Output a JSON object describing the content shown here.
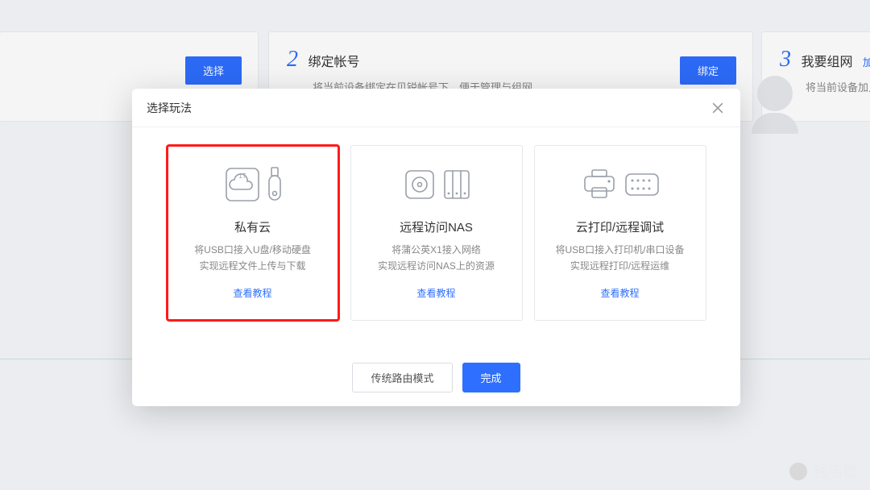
{
  "bg": {
    "step1_select_btn": "选择",
    "step2_num": "2",
    "step2_title": "绑定帐号",
    "step2_desc": "将当前设备绑定在贝锐帐号下，便于管理与组网",
    "step2_btn": "绑定",
    "step3_num": "3",
    "step3_title": "我要组网",
    "step3_link": "加入已",
    "step3_desc": "将当前设备加入到"
  },
  "modal": {
    "title": "选择玩法",
    "options": [
      {
        "title": "私有云",
        "desc": "将USB口接入U盘/移动硬盘\n实现远程文件上传与下载",
        "link": "查看教程"
      },
      {
        "title": "远程访问NAS",
        "desc": "将蒲公英X1接入网络\n实现远程访问NAS上的资源",
        "link": "查看教程"
      },
      {
        "title": "云打印/远程调试",
        "desc": "将USB口接入打印机/串口设备\n实现远程打印/远程运维",
        "link": "查看教程"
      }
    ],
    "footer": {
      "secondary": "传统路由模式",
      "primary": "完成"
    }
  },
  "watermark": "钱韦德"
}
